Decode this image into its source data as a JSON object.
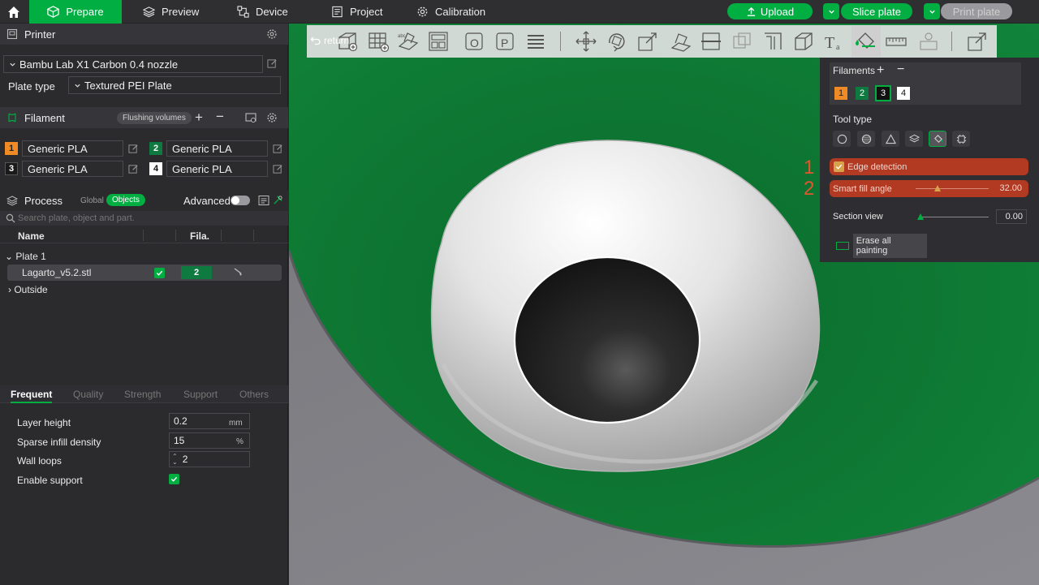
{
  "topbar": {
    "tabs": [
      {
        "label": "Prepare"
      },
      {
        "label": "Preview"
      },
      {
        "label": "Device"
      },
      {
        "label": "Project"
      },
      {
        "label": "Calibration"
      }
    ],
    "upload_label": "Upload",
    "slice_label": "Slice plate",
    "print_label": "Print plate"
  },
  "printer": {
    "header": "Printer",
    "model": "Bambu Lab X1 Carbon 0.4 nozzle",
    "plate_type_label": "Plate type",
    "plate_type_value": "Textured PEI Plate"
  },
  "filament": {
    "header": "Filament",
    "flushing_label": "Flushing volumes",
    "slots": [
      {
        "num": "1",
        "name": "Generic PLA",
        "color": "#f08a24"
      },
      {
        "num": "2",
        "name": "Generic PLA",
        "color": "#0f7a40"
      },
      {
        "num": "3",
        "name": "Generic PLA",
        "color": "#1a1a1a"
      },
      {
        "num": "4",
        "name": "Generic PLA",
        "color": "#ffffff"
      }
    ]
  },
  "process": {
    "header": "Process",
    "global_label": "Global",
    "objects_label": "Objects",
    "advanced_label": "Advanced",
    "search_placeholder": "Search plate, object and part.",
    "col_name": "Name",
    "col_fila": "Fila.",
    "plate": "Plate 1",
    "object_name": "Lagarto_v5.2.stl",
    "object_fila": "2",
    "outside": "Outside"
  },
  "settings": {
    "tabs": [
      "Frequent",
      "Quality",
      "Strength",
      "Support",
      "Others"
    ],
    "layer_height_label": "Layer height",
    "layer_height_value": "0.2",
    "layer_height_unit": "mm",
    "infill_label": "Sparse infill density",
    "infill_value": "15",
    "infill_unit": "%",
    "wall_label": "Wall loops",
    "wall_value": "2",
    "support_label": "Enable support"
  },
  "viewport": {
    "return_label": "return"
  },
  "paint_panel": {
    "filaments_label": "Filaments",
    "filament_nums": [
      "1",
      "2",
      "3",
      "4"
    ],
    "tool_type_label": "Tool type",
    "edge_detection_label": "Edge detection",
    "smart_fill_label": "Smart fill angle",
    "smart_fill_value": "32.00",
    "smart_fill_fraction": 0.3,
    "section_view_label": "Section view",
    "section_view_value": "0.00",
    "section_view_fraction": 0.0,
    "erase_label": "Erase all painting",
    "marker_1": "1",
    "marker_2": "2"
  },
  "colors": {
    "accent": "#00ae42",
    "viewport_green": "#0e7a33",
    "highlight_red": "#b23a22"
  }
}
